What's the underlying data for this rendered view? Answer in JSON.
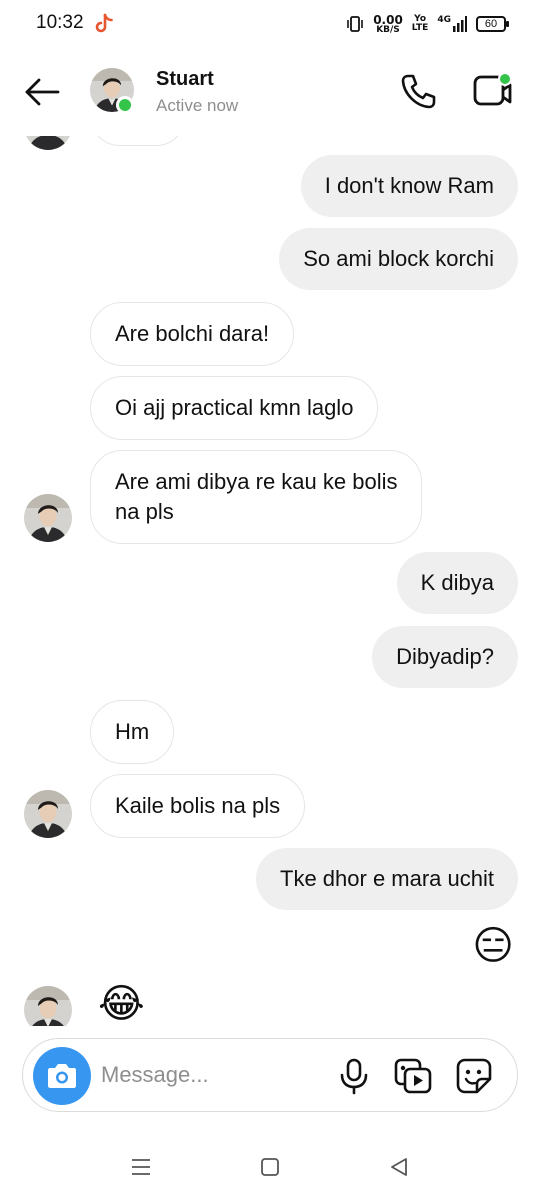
{
  "status_bar": {
    "time": "10:32",
    "net_speed": "0.00",
    "net_unit": "KB/S",
    "volte_top": "Yo",
    "volte_bottom": "LTE",
    "network": "4G",
    "battery": "60"
  },
  "header": {
    "name": "Stuart",
    "status": "Active now"
  },
  "messages": [
    {
      "side": "out",
      "text": "I don't know Ram"
    },
    {
      "side": "out",
      "text": "So ami block korchi"
    },
    {
      "side": "in",
      "text": "Are bolchi dara!"
    },
    {
      "side": "in",
      "text": "Oi ajj practical kmn laglo"
    },
    {
      "side": "in",
      "text_lines": [
        "Are ami dibya re kau ke bolis",
        "na pls"
      ]
    },
    {
      "side": "out",
      "text": "K dibya"
    },
    {
      "side": "out",
      "text": "Dibyadip?"
    },
    {
      "side": "in",
      "text": "Hm"
    },
    {
      "side": "in",
      "text": "Kaile bolis na pls"
    },
    {
      "side": "out",
      "text": "Tke dhor e mara uchit"
    },
    {
      "side": "out",
      "emoji": "😑"
    },
    {
      "side": "in",
      "emoji": "😂"
    }
  ],
  "composer": {
    "placeholder": "Message..."
  },
  "colors": {
    "accent": "#3797f0",
    "online": "#35c44a",
    "outgoing_bubble": "#efefef",
    "incoming_border": "#e6e6e6",
    "secondary_text": "#8e8e8e"
  },
  "icons": [
    "back-arrow-icon",
    "phone-icon",
    "video-icon",
    "camera-icon",
    "mic-icon",
    "gallery-icon",
    "sticker-icon",
    "tiktok-icon",
    "nav-menu-icon",
    "nav-home-icon",
    "nav-back-icon"
  ]
}
